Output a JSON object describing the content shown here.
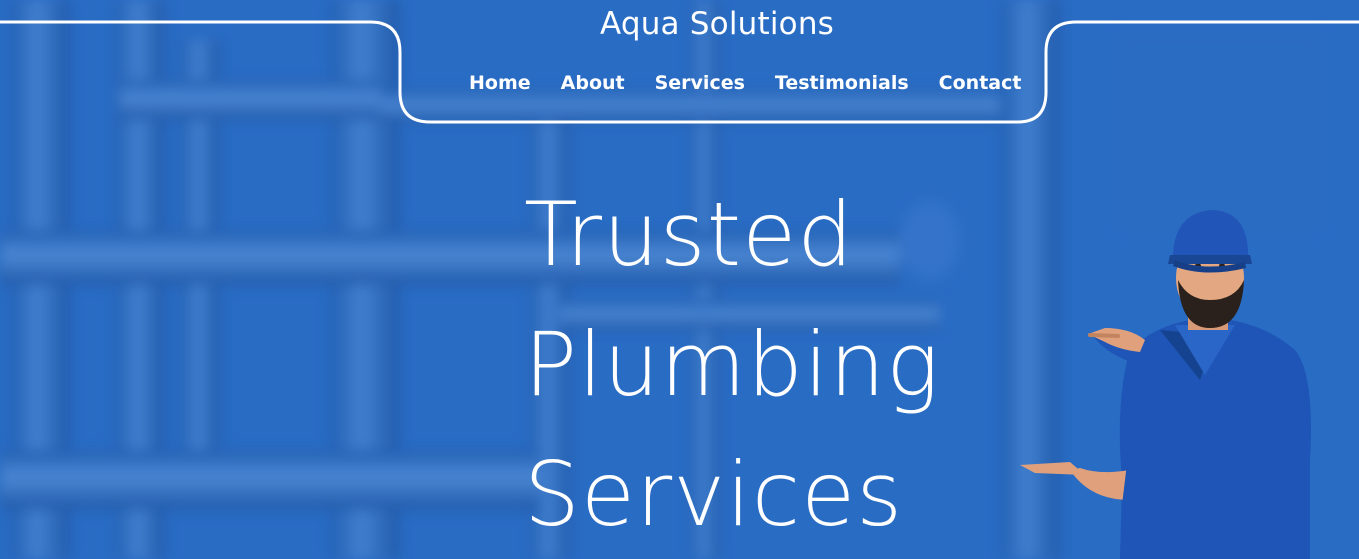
{
  "site": {
    "brand": "Aqua Solutions"
  },
  "nav": {
    "items": [
      {
        "label": "Home"
      },
      {
        "label": "About"
      },
      {
        "label": "Services"
      },
      {
        "label": "Testimonials"
      },
      {
        "label": "Contact"
      }
    ]
  },
  "hero": {
    "headline_lines": [
      "Trusted",
      "Plumbing",
      "Services"
    ]
  },
  "colors": {
    "background": "#2a6fc4",
    "text": "#ffffff",
    "uniform": "#1f56b8"
  }
}
